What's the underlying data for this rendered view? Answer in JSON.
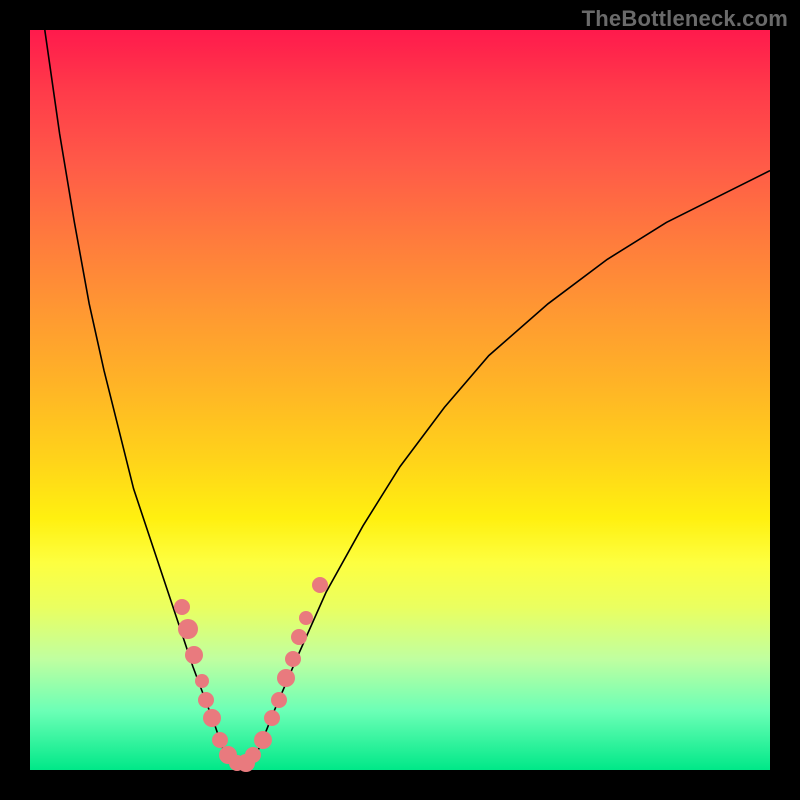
{
  "watermark": "TheBottleneck.com",
  "colors": {
    "frame": "#000000",
    "curve": "#000000",
    "marker": "#e97a7e"
  },
  "chart_data": {
    "type": "line",
    "title": "",
    "xlabel": "",
    "ylabel": "",
    "xlim": [
      0,
      100
    ],
    "ylim": [
      0,
      100
    ],
    "grid": false,
    "series": [
      {
        "name": "left-branch",
        "x": [
          2,
          4,
          6,
          8,
          10,
          12,
          14,
          16,
          18,
          20,
          22,
          23.5,
          25,
          26
        ],
        "y": [
          100,
          86,
          74,
          63,
          54,
          46,
          38,
          32,
          26,
          20,
          14,
          10,
          6,
          3
        ]
      },
      {
        "name": "valley-floor",
        "x": [
          26,
          27,
          28,
          29,
          30,
          31
        ],
        "y": [
          3,
          1.5,
          1,
          1,
          1.5,
          3
        ]
      },
      {
        "name": "right-branch",
        "x": [
          31,
          33,
          36,
          40,
          45,
          50,
          56,
          62,
          70,
          78,
          86,
          94,
          100
        ],
        "y": [
          3,
          8,
          15,
          24,
          33,
          41,
          49,
          56,
          63,
          69,
          74,
          78,
          81
        ]
      }
    ],
    "markers": [
      {
        "x": 20.5,
        "y": 22,
        "r": 8
      },
      {
        "x": 21.3,
        "y": 19,
        "r": 10
      },
      {
        "x": 22.2,
        "y": 15.5,
        "r": 9
      },
      {
        "x": 23.2,
        "y": 12,
        "r": 7
      },
      {
        "x": 23.8,
        "y": 9.5,
        "r": 8
      },
      {
        "x": 24.6,
        "y": 7,
        "r": 9
      },
      {
        "x": 25.7,
        "y": 4,
        "r": 8
      },
      {
        "x": 26.8,
        "y": 2,
        "r": 9
      },
      {
        "x": 28.0,
        "y": 1,
        "r": 8
      },
      {
        "x": 29.2,
        "y": 1,
        "r": 9
      },
      {
        "x": 30.2,
        "y": 2,
        "r": 8
      },
      {
        "x": 31.5,
        "y": 4,
        "r": 9
      },
      {
        "x": 32.7,
        "y": 7,
        "r": 8
      },
      {
        "x": 33.6,
        "y": 9.5,
        "r": 8
      },
      {
        "x": 34.6,
        "y": 12.5,
        "r": 9
      },
      {
        "x": 35.5,
        "y": 15,
        "r": 8
      },
      {
        "x": 36.4,
        "y": 18,
        "r": 8
      },
      {
        "x": 37.3,
        "y": 20.5,
        "r": 7
      },
      {
        "x": 39.2,
        "y": 25,
        "r": 8
      }
    ]
  }
}
